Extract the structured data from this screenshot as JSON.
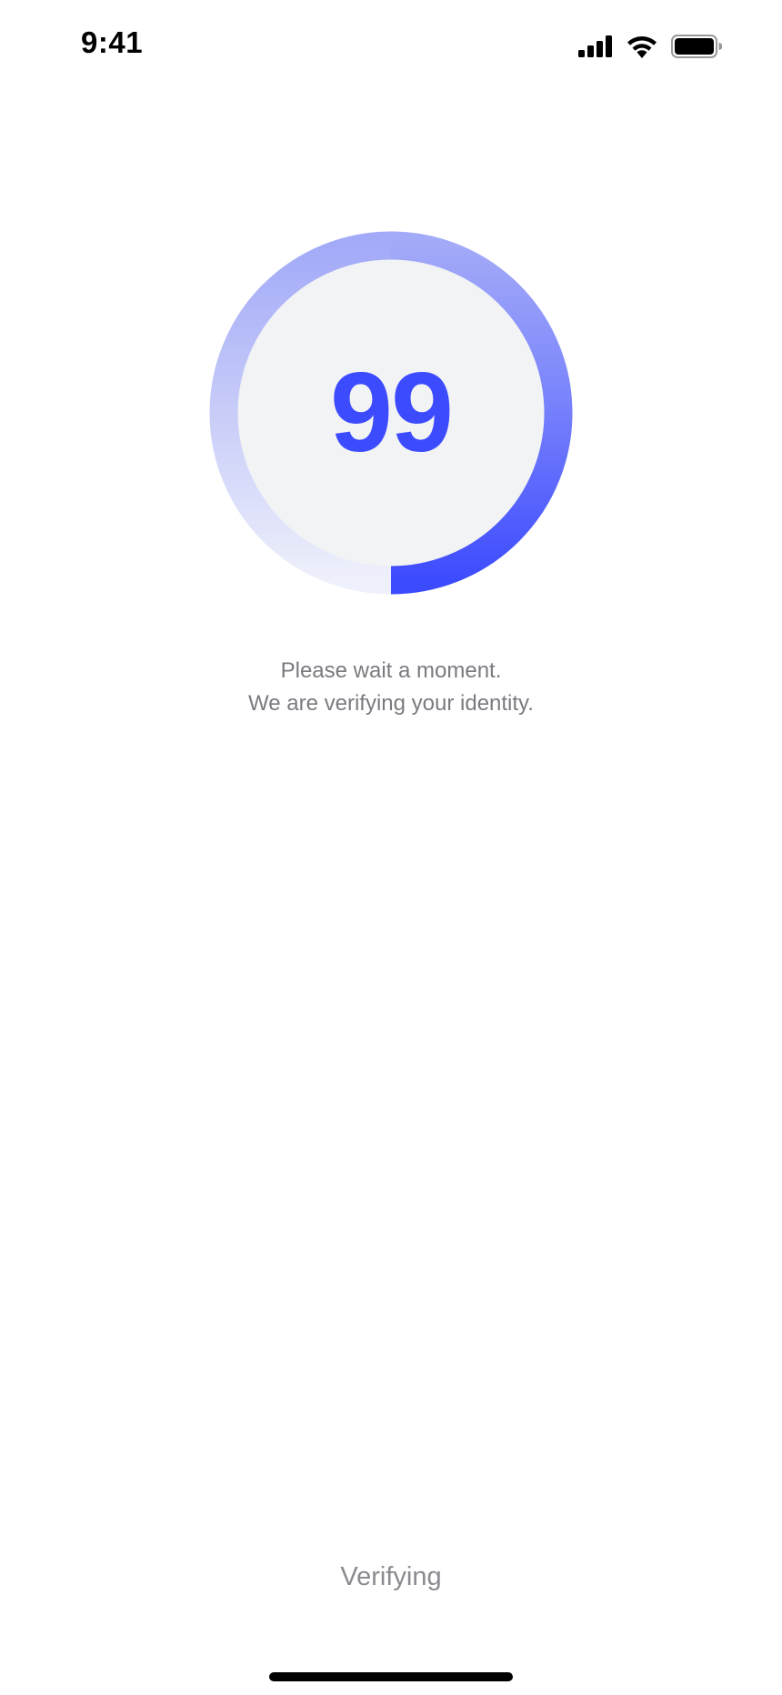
{
  "status_bar": {
    "time": "9:41",
    "icons": [
      "cellular-signal-icon",
      "wifi-icon",
      "battery-icon"
    ]
  },
  "progress": {
    "value_text": "99",
    "fraction": 0.99,
    "accent_color": "#3d4bff",
    "track_inner_color": "#f2f3f5"
  },
  "message": {
    "line1": "Please wait a moment.",
    "line2": "We are verifying your identity."
  },
  "footer": {
    "status_label": "Verifying"
  }
}
